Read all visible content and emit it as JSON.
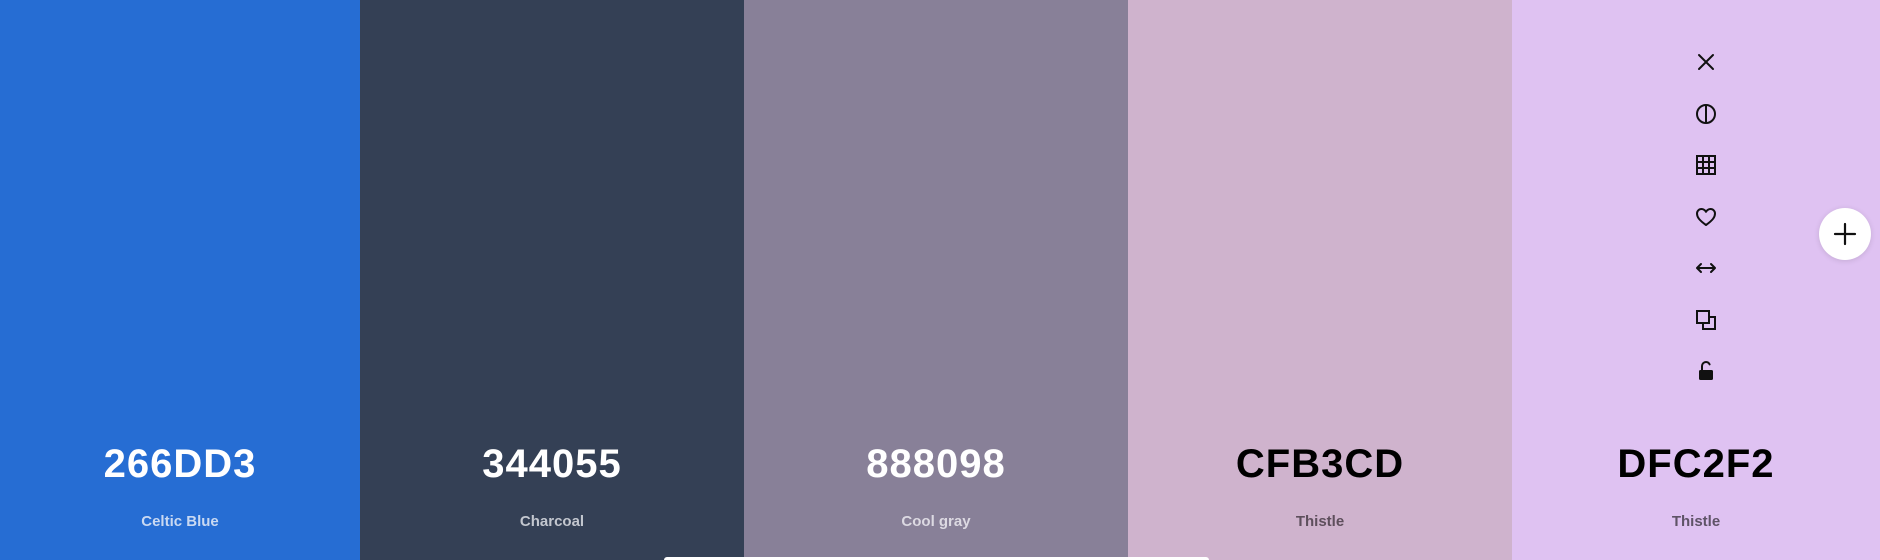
{
  "swatches": [
    {
      "hex": "266DD3",
      "name": "Celtic Blue",
      "bg": "#266DD3",
      "text_color": "#ffffff",
      "name_color": "#c9d9f2"
    },
    {
      "hex": "344055",
      "name": "Charcoal",
      "bg": "#344055",
      "text_color": "#ffffff",
      "name_color": "#c3c7cf"
    },
    {
      "hex": "888098",
      "name": "Cool gray",
      "bg": "#888098",
      "text_color": "#ffffff",
      "name_color": "#dcd9e2"
    },
    {
      "hex": "CFB3CD",
      "name": "Thistle",
      "bg": "#CFB3CD",
      "text_color": "#000000",
      "name_color": "#5e4f5c"
    },
    {
      "hex": "DFC2F2",
      "name": "Thistle",
      "bg": "#DFC2F2",
      "text_color": "#000000",
      "name_color": "#5f5367"
    }
  ],
  "toolbar": {
    "icons": [
      "close-icon",
      "contrast-icon",
      "grid-icon",
      "heart-icon",
      "drag-horizontal-icon",
      "copy-icon",
      "lock-icon"
    ]
  },
  "add_button": {
    "icon": "plus-icon"
  }
}
